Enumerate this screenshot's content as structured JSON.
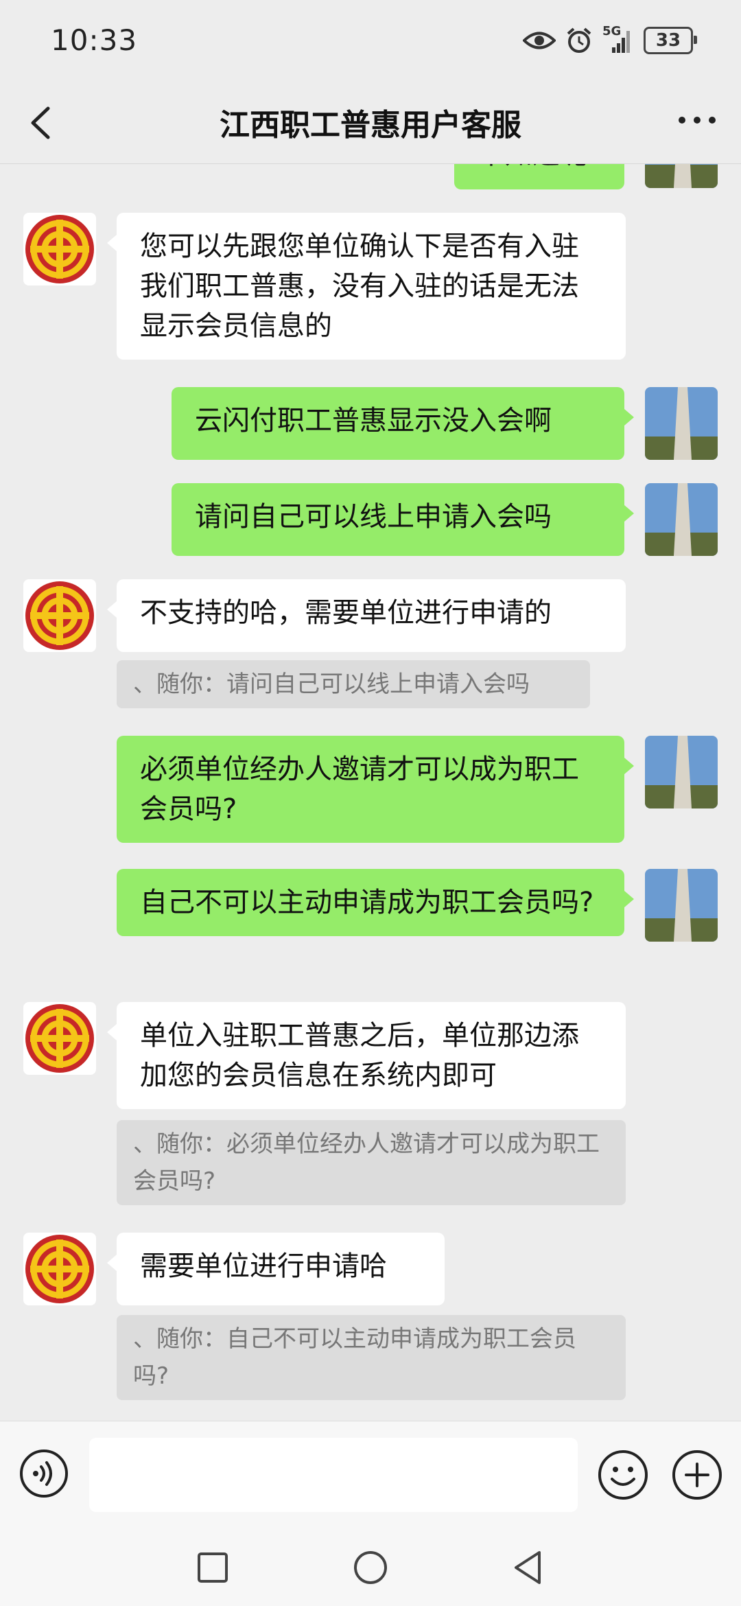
{
  "status_bar": {
    "time": "10:33",
    "network": "5G",
    "battery": "33"
  },
  "header": {
    "title": "江西职工普惠用户客服"
  },
  "messages": [
    {
      "from": "me",
      "text": "不知道呢"
    },
    {
      "from": "agent",
      "text": "您可以先跟您单位确认下是否有入驻我们职工普惠，没有入驻的话是无法显示会员信息的"
    },
    {
      "from": "me",
      "text": "云闪付职工普惠显示没入会啊"
    },
    {
      "from": "me",
      "text": "请问自己可以线上申请入会吗"
    },
    {
      "from": "agent",
      "text": "不支持的哈，需要单位进行申请的",
      "quote": "、随你：请问自己可以线上申请入会吗"
    },
    {
      "from": "me",
      "text": "必须单位经办人邀请才可以成为职工会员吗?"
    },
    {
      "from": "me",
      "text": "自己不可以主动申请成为职工会员吗?"
    },
    {
      "from": "agent",
      "text": "单位入驻职工普惠之后，单位那边添加您的会员信息在系统内即可",
      "quote": "、随你：必须单位经办人邀请才可以成为职工会员吗?"
    },
    {
      "from": "agent",
      "text": "需要单位进行申请哈",
      "quote": "、随你：自己不可以主动申请成为职工会员吗?"
    }
  ],
  "input": {
    "value": "",
    "placeholder": ""
  },
  "icons": {
    "back": "chevron-left-icon",
    "more": "more-dots-icon",
    "voice": "voice-icon",
    "emoji": "emoji-icon",
    "plus": "plus-icon",
    "nav_recent": "square-icon",
    "nav_home": "circle-icon",
    "nav_back": "triangle-back-icon"
  },
  "colors": {
    "sent_bubble": "#95ec69",
    "received_bubble": "#ffffff",
    "background": "#ededed",
    "logo_red": "#c62828",
    "logo_gold": "#f5c518"
  }
}
